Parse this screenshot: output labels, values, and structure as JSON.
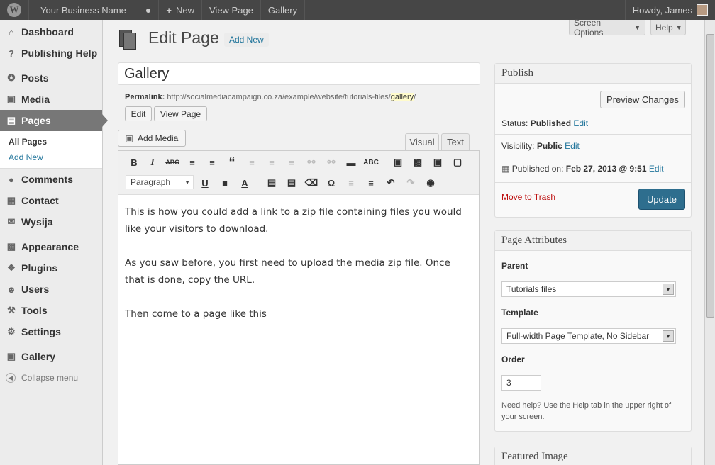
{
  "admin_bar": {
    "site_name": "Your Business Name",
    "new_label": "New",
    "view_page": "View Page",
    "gallery": "Gallery",
    "howdy": "Howdy, James"
  },
  "sidebar": {
    "items": [
      {
        "label": "Dashboard",
        "icon": "dashboard-icon"
      },
      {
        "label": "Publishing Help",
        "icon": "question-icon"
      },
      {
        "label": "Posts",
        "icon": "pushpin-icon"
      },
      {
        "label": "Media",
        "icon": "media-icon"
      },
      {
        "label": "Pages",
        "icon": "pages-icon"
      },
      {
        "label": "Comments",
        "icon": "comment-icon"
      },
      {
        "label": "Contact",
        "icon": "contact-icon"
      },
      {
        "label": "Wysija",
        "icon": "mail-icon"
      },
      {
        "label": "Appearance",
        "icon": "appearance-icon"
      },
      {
        "label": "Plugins",
        "icon": "plugin-icon"
      },
      {
        "label": "Users",
        "icon": "users-icon"
      },
      {
        "label": "Tools",
        "icon": "tools-icon"
      },
      {
        "label": "Settings",
        "icon": "settings-icon"
      },
      {
        "label": "Gallery",
        "icon": "gallery-icon"
      }
    ],
    "submenu": {
      "all_pages": "All Pages",
      "add_new": "Add New"
    },
    "collapse": "Collapse menu"
  },
  "screen_options": "Screen Options",
  "help": "Help",
  "heading": {
    "title": "Edit Page",
    "add_new": "Add New"
  },
  "post_title": "Gallery",
  "permalink": {
    "label": "Permalink:",
    "url": "http://socialmediacampaign.co.za/example/website/tutorials-files/",
    "slug": "gallery",
    "trail": "/",
    "edit": "Edit",
    "view_page": "View Page"
  },
  "editor": {
    "add_media": "Add Media",
    "tab_visual": "Visual",
    "tab_text": "Text",
    "format": "Paragraph",
    "paragraphs": [
      "This is how you could add a link to a zip file containing files you would like your visitors to download.",
      "As you saw before, you first need to upload the media zip file. Once that is done, copy the URL.",
      "Then come to a page like this"
    ]
  },
  "publish": {
    "title": "Publish",
    "preview": "Preview Changes",
    "status_label": "Status:",
    "status_value": "Published",
    "visibility_label": "Visibility:",
    "visibility_value": "Public",
    "published_on_label": "Published on:",
    "published_on_value": "Feb 27, 2013 @ 9:51",
    "edit": "Edit",
    "trash": "Move to Trash",
    "update": "Update"
  },
  "page_attributes": {
    "title": "Page Attributes",
    "parent_label": "Parent",
    "parent_value": "Tutorials files",
    "template_label": "Template",
    "template_value": "Full-width Page Template, No Sidebar",
    "order_label": "Order",
    "order_value": "3",
    "help": "Need help? Use the Help tab in the upper right of your screen."
  },
  "featured_image": {
    "title": "Featured Image"
  },
  "colors": {
    "update_button": "#2e6e8e",
    "link": "#21759b",
    "current_menu": "#777777"
  }
}
